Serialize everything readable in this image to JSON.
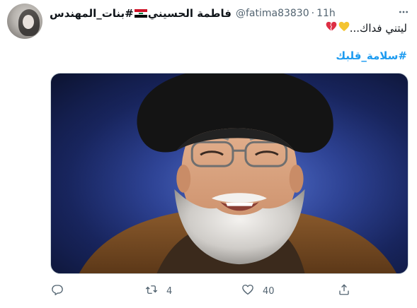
{
  "author": {
    "display_name": "فاطمة الحسيني",
    "hashtag_name": "#بنات_المهندس",
    "handle": "@fatima83830",
    "separator": "·",
    "time": "11h"
  },
  "tweet": {
    "text": "ليتني فداك...",
    "hashtag": "#سلامة_قلبك"
  },
  "icons": {
    "more": "more-icon",
    "heart_yellow": "yellow-heart-icon",
    "heart_broken": "broken-heart-icon",
    "reply": "reply-icon",
    "retweet": "retweet-icon",
    "like": "like-icon",
    "share": "share-icon"
  },
  "actions": {
    "reply_count": "",
    "retweet_count": "4",
    "like_count": "40"
  },
  "colors": {
    "link": "#1d9bf0",
    "muted": "#536471",
    "text": "#0f1419",
    "media_bg": "#2a3f96"
  }
}
